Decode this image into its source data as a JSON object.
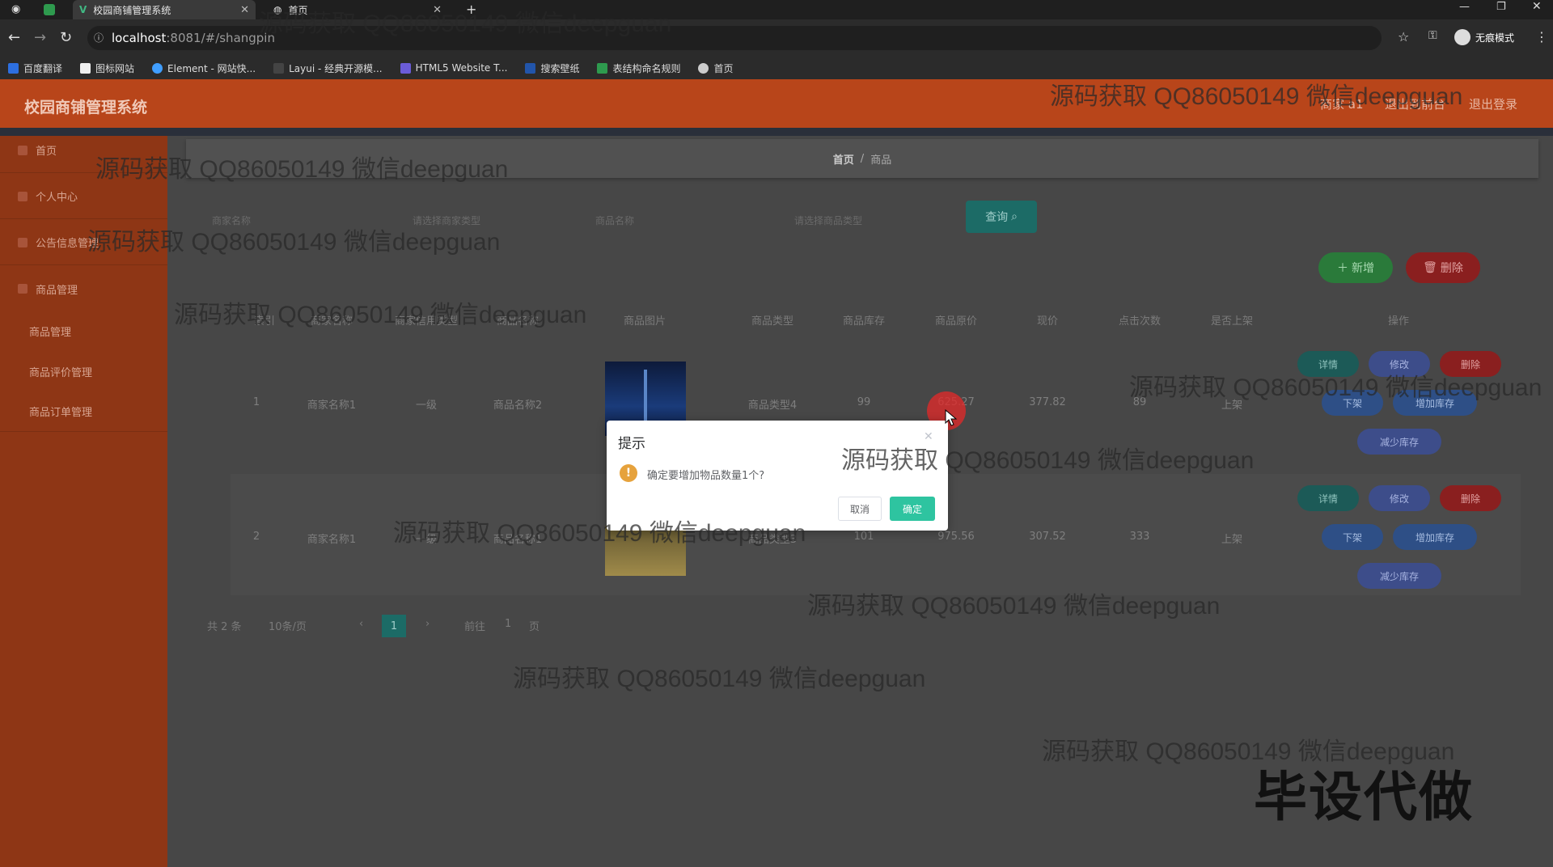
{
  "browser": {
    "tabs": [
      {
        "title": "校园商铺管理系统",
        "active": true
      },
      {
        "title": "首页",
        "active": false
      }
    ],
    "url_host": "localhost",
    "url_path": ":8081/#/shangpin",
    "incognito_label": "无痕模式",
    "bookmarks": [
      "百度翻译",
      "图标网站",
      "Element - 网站快...",
      "Layui - 经典开源模...",
      "HTML5 Website T...",
      "搜索壁纸",
      "表结构命名规则",
      "首页"
    ]
  },
  "header": {
    "title": "校园商铺管理系统",
    "user": "商家 a1",
    "back_to_front": "退出到前台",
    "logout": "退出登录"
  },
  "sidebar": {
    "items": [
      {
        "label": "首页"
      },
      {
        "label": "个人中心"
      },
      {
        "label": "公告信息管理"
      },
      {
        "label": "商品管理"
      }
    ],
    "sub_items": [
      {
        "label": "商品管理"
      },
      {
        "label": "商品评价管理"
      },
      {
        "label": "商品订单管理"
      }
    ]
  },
  "breadcrumb": {
    "home": "首页",
    "separator": "/",
    "current": "商品"
  },
  "search": {
    "field1": "商家名称",
    "field2": "请选择商家类型",
    "field3": "商品名称",
    "field4": "请选择商品类型",
    "query_label": "查询"
  },
  "toolbar": {
    "add_label": "新增",
    "delete_label": "删除"
  },
  "table": {
    "headers": [
      "索引",
      "商家名称",
      "商家信用类型",
      "商品名称",
      "商品图片",
      "商品类型",
      "商品库存",
      "商品原价",
      "现价",
      "点击次数",
      "是否上架",
      "操作"
    ],
    "rows": [
      {
        "index": "1",
        "merchant": "商家名称1",
        "credit": "一级",
        "name": "商品名称2",
        "type": "商品类型4",
        "stock": "99",
        "orig_price": "625.27",
        "price": "377.82",
        "clicks": "89",
        "on_shelf": "上架"
      },
      {
        "index": "2",
        "merchant": "商家名称1",
        "credit": "一级",
        "name": "商品名称1",
        "type": "商品类型3",
        "stock": "101",
        "orig_price": "975.56",
        "price": "307.52",
        "clicks": "333",
        "on_shelf": "上架"
      }
    ],
    "row_actions": {
      "detail": "详情",
      "edit": "修改",
      "delete": "删除",
      "off_shelf": "下架",
      "add_stock": "增加库存",
      "reduce_stock": "减少库存"
    }
  },
  "pagination": {
    "total": "共 2 条",
    "page_size": "10条/页",
    "current": "1",
    "goto_prefix": "前往",
    "goto_value": "1",
    "goto_suffix": "页"
  },
  "dialog": {
    "title": "提示",
    "message": "确定要增加物品数量1个?",
    "cancel": "取消",
    "confirm": "确定"
  },
  "watermark": {
    "text": "源码获取 QQ86050149 微信deepguan",
    "big": "毕设代做"
  },
  "colors": {
    "header_bg": "#b8451a",
    "sidebar_bg": "#8e3615",
    "confirm": "#2ec4a0",
    "warning": "#e6a23c"
  }
}
